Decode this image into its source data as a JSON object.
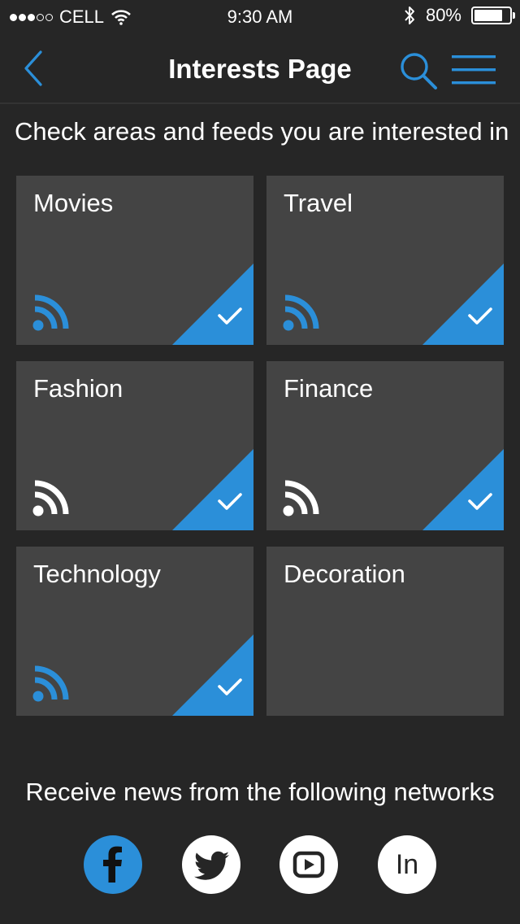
{
  "status_bar": {
    "carrier": "CELL",
    "time": "9:30 AM",
    "battery_percent": "80%",
    "battery_level": 0.8,
    "signal_bars_filled": 3,
    "signal_bars_total": 5
  },
  "nav": {
    "title": "Interests Page",
    "back_icon": "chevron-left-icon",
    "search_icon": "search-icon",
    "menu_icon": "hamburger-menu-icon"
  },
  "instructions": "Check areas and feeds you are interested in",
  "tiles": [
    {
      "label": "Movies",
      "feed_subscribed": true,
      "checked": true
    },
    {
      "label": "Travel",
      "feed_subscribed": true,
      "checked": true
    },
    {
      "label": "Fashion",
      "feed_subscribed": false,
      "checked": true
    },
    {
      "label": "Finance",
      "feed_subscribed": false,
      "checked": true
    },
    {
      "label": "Technology",
      "feed_subscribed": true,
      "checked": true
    },
    {
      "label": "Decoration",
      "feed_subscribed": false,
      "checked": false
    }
  ],
  "networks": {
    "title": "Receive news from the following networks",
    "items": [
      {
        "name": "facebook",
        "icon": "facebook-icon",
        "selected": true
      },
      {
        "name": "twitter",
        "icon": "twitter-icon",
        "selected": false
      },
      {
        "name": "youtube",
        "icon": "youtube-icon",
        "selected": false
      },
      {
        "name": "linkedin",
        "icon": "linkedin-icon",
        "selected": false,
        "glyph": "In"
      }
    ]
  },
  "colors": {
    "accent": "#2b8fd9",
    "background": "#262626",
    "tile": "#444444",
    "text": "#ffffff"
  }
}
